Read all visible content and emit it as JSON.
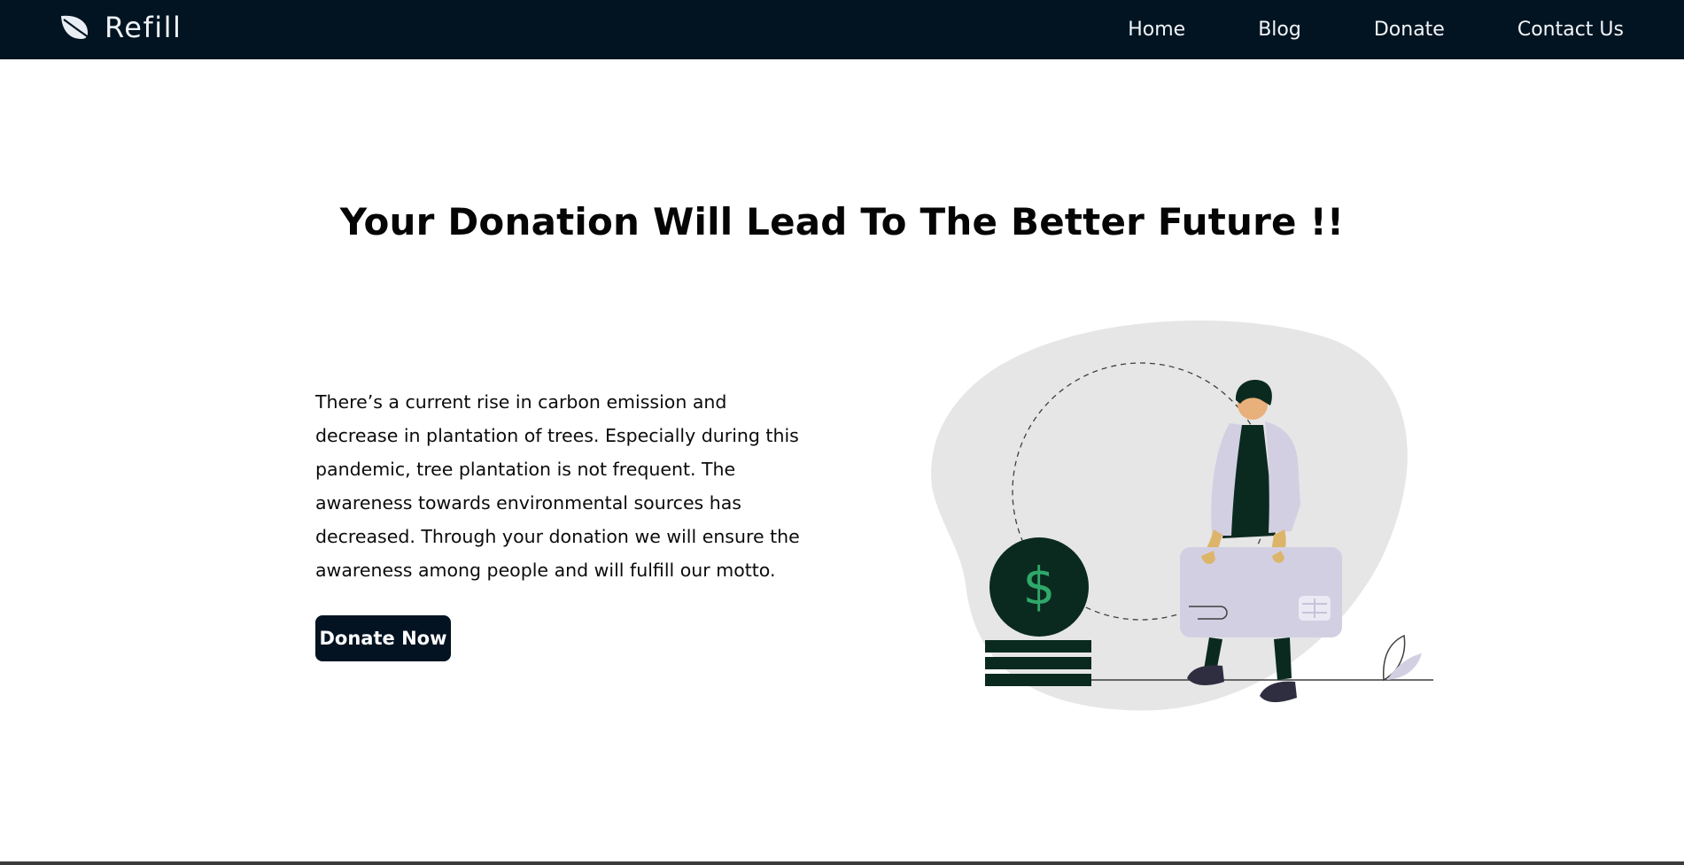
{
  "brand": {
    "name": "Refill",
    "icon": "leaf-icon"
  },
  "nav": {
    "items": [
      {
        "label": "Home"
      },
      {
        "label": "Blog"
      },
      {
        "label": "Donate"
      },
      {
        "label": "Contact Us"
      }
    ]
  },
  "hero": {
    "title": "Your Donation Will Lead To The Better Future !!",
    "description": "There’s a current rise in carbon emission and decrease in plantation of trees. Especially during this pandemic, tree plantation is not frequent. The awareness towards environmental sources has decreased. Through your donation we will ensure the awareness among people and will fulfill our motto.",
    "cta_label": "Donate Now",
    "illustration": {
      "icon": "donation-illustration",
      "coin_symbol": "$"
    }
  },
  "colors": {
    "navbar_bg": "#021421",
    "button_bg": "#031322",
    "dark_green": "#0b2a1f",
    "accent_green": "#2fa86a",
    "card_lavender": "#d3cfe3",
    "blob_gray": "#e6e6e6"
  }
}
